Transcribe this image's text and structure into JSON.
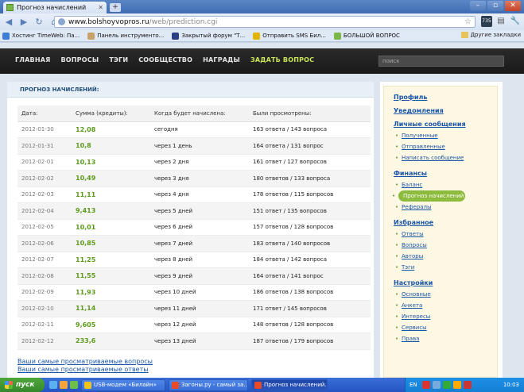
{
  "browser": {
    "tab_title": "Прогноз начислений",
    "new_tab": "+",
    "url_host": "www.bolshoyvopros.ru",
    "url_path": "/web/prediction.cgi",
    "ext_badge": "735",
    "bookmarks": [
      {
        "label": "Хостинг TimeWeb: Па...",
        "color": "#3b7fd6"
      },
      {
        "label": "Панель инструменто...",
        "color": "#c8a06a"
      },
      {
        "label": "Закрытый форум \"Т...",
        "color": "#2a3f86"
      },
      {
        "label": "Отправить SMS Бил...",
        "color": "#e3b400"
      },
      {
        "label": "БОЛЬШОЙ ВОПРОС",
        "color": "#7ab648"
      }
    ],
    "other_bookmarks": "Другие закладки"
  },
  "site": {
    "nav": [
      "ГЛАВНАЯ",
      "ВОПРОСЫ",
      "ТЭГИ",
      "СООБЩЕСТВО",
      "НАГРАДЫ"
    ],
    "ask": "ЗАДАТЬ ВОПРОС",
    "search_placeholder": "поиск"
  },
  "main": {
    "heading": "ПРОГНОЗ НАЧИСЛЕНИЙ:",
    "columns": [
      "Дата:",
      "Сумма (кредиты):",
      "Когда будет начислена:",
      "Были просмотрены:"
    ],
    "rows": [
      {
        "date": "2012-01-30",
        "amount": "12,08",
        "when": "сегодня",
        "viewed": "163 ответа / 143 вопроса"
      },
      {
        "date": "2012-01-31",
        "amount": "10,8",
        "when": "через 1 день",
        "viewed": "164 ответа / 131 вопрос"
      },
      {
        "date": "2012-02-01",
        "amount": "10,13",
        "when": "через 2 дня",
        "viewed": "161 ответ / 127 вопросов"
      },
      {
        "date": "2012-02-02",
        "amount": "10,49",
        "when": "через 3 дня",
        "viewed": "180 ответов / 133 вопроса"
      },
      {
        "date": "2012-02-03",
        "amount": "11,11",
        "when": "через 4 дня",
        "viewed": "178 ответов / 115 вопросов"
      },
      {
        "date": "2012-02-04",
        "amount": "9,413",
        "when": "через 5 дней",
        "viewed": "151 ответ / 135 вопросов"
      },
      {
        "date": "2012-02-05",
        "amount": "10,01",
        "when": "через 6 дней",
        "viewed": "157 ответов / 128 вопросов"
      },
      {
        "date": "2012-02-06",
        "amount": "10,85",
        "when": "через 7 дней",
        "viewed": "183 ответа / 140 вопросов"
      },
      {
        "date": "2012-02-07",
        "amount": "11,25",
        "when": "через 8 дней",
        "viewed": "184 ответа / 142 вопроса"
      },
      {
        "date": "2012-02-08",
        "amount": "11,55",
        "when": "через 9 дней",
        "viewed": "164 ответа / 141 вопрос"
      },
      {
        "date": "2012-02-09",
        "amount": "11,93",
        "when": "через 10 дней",
        "viewed": "186 ответов / 138 вопросов"
      },
      {
        "date": "2012-02-10",
        "amount": "11,14",
        "when": "через 11 дней",
        "viewed": "171 ответ / 145 вопросов"
      },
      {
        "date": "2012-02-11",
        "amount": "9,605",
        "when": "через 12 дней",
        "viewed": "148 ответов / 128 вопросов"
      },
      {
        "date": "2012-02-12",
        "amount": "233,6",
        "when": "через 13 дней",
        "viewed": "187 ответов / 179 вопросов"
      }
    ],
    "links": [
      "Ваши самые просматриваемые вопросы",
      "Ваши самые просматриваемые ответы"
    ]
  },
  "sidebar": {
    "sections": [
      {
        "title": "Профиль",
        "items": []
      },
      {
        "title": "Уведомления",
        "items": []
      },
      {
        "title": "Личные сообщения",
        "items": [
          "Полученные",
          "Отправленные",
          "Написать сообщение"
        ]
      },
      {
        "title": "Финансы",
        "items": [
          "Баланс",
          "Прогноз начислений",
          "Рефералы"
        ]
      },
      {
        "title": "Избранное",
        "items": [
          "Ответы",
          "Вопросы",
          "Авторы",
          "Тэги"
        ]
      },
      {
        "title": "Настройки",
        "items": [
          "Основные",
          "Анкета",
          "Интересы",
          "Сервисы",
          "Права"
        ]
      }
    ],
    "active_item": "Прогноз начислений"
  },
  "taskbar": {
    "start": "пуск",
    "tasks": [
      {
        "label": "USB-модем «Билайн»",
        "color": "#f0c419"
      },
      {
        "label": "Загоны.ру - самый за...",
        "color": "#e84a2a"
      },
      {
        "label": "Прогноз начислений...",
        "color": "#e84a2a"
      }
    ],
    "lang": "EN",
    "clock": "10:03"
  }
}
